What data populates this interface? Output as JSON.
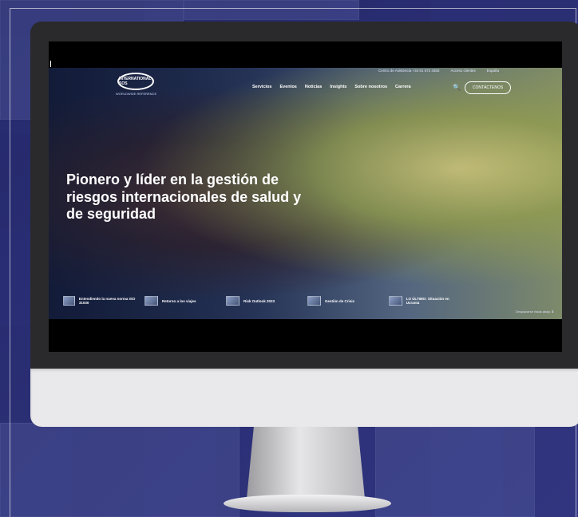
{
  "site": {
    "logo_text": "INTERNATIONAL SOS",
    "logo_sub": "WORLDWIDE REFERENCE",
    "top_links": [
      "Centro de Asistencia +34 91 572 4363",
      "Acceso clientes",
      "España"
    ],
    "menu": [
      "Servicios",
      "Eventos",
      "Noticias",
      "Insights",
      "Sobre nosotros",
      "Carrera"
    ],
    "search_icon": "🔍",
    "cta_label": "CONTÁCTENOS",
    "headline": "Pionero y líder en la gestión de riesgos internacionales de salud y de seguridad",
    "news": [
      {
        "label": "Entendiendo la nueva norma ISO 31030"
      },
      {
        "label": "Retorno a los viajes"
      },
      {
        "label": "Risk Outlook 2023"
      },
      {
        "label": "Gestión de Crisis"
      },
      {
        "label": "LO ÚLTIMO: Situación en Ucrania"
      }
    ],
    "scroll_hint": "Desplazarse hacia abajo ⬇"
  },
  "colors": {
    "accent": "#2f3e63",
    "brand": "#ffffff"
  }
}
